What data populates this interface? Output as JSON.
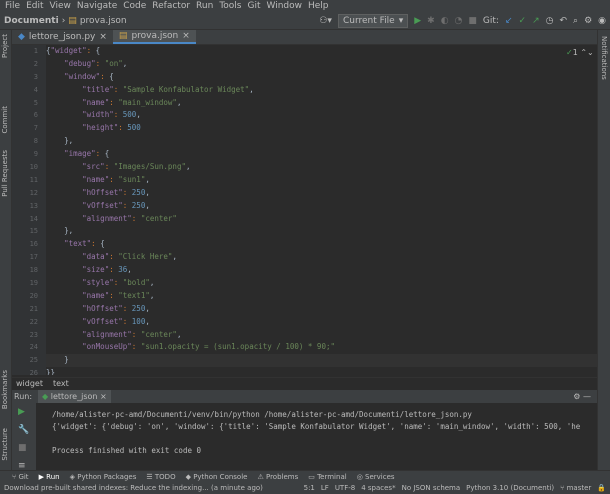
{
  "menu": [
    "File",
    "Edit",
    "View",
    "Navigate",
    "Code",
    "Refactor",
    "Run",
    "Tools",
    "Git",
    "Window",
    "Help"
  ],
  "breadcrumb": {
    "project": "Documenti",
    "file": "prova.json"
  },
  "toolbar": {
    "run_config": "Current File",
    "git_label": "Git:"
  },
  "left_tools": [
    "Project",
    "Commit",
    "Pull Requests"
  ],
  "left_tools_bottom": [
    "Bookmarks",
    "Structure"
  ],
  "right_tools": [
    "Notifications"
  ],
  "tabs": [
    {
      "label": "lettore_json.py"
    },
    {
      "label": "prova.json"
    }
  ],
  "inspection": "1",
  "editor_breadcrumb": [
    "widget",
    "text"
  ],
  "lines": [
    {
      "n": "1",
      "t": "{\"widget\": {"
    },
    {
      "n": "2",
      "t": "    \"debug\": \"on\","
    },
    {
      "n": "3",
      "t": "    \"window\": {"
    },
    {
      "n": "4",
      "t": "        \"title\": \"Sample Konfabulator Widget\","
    },
    {
      "n": "5",
      "t": "        \"name\": \"main_window\","
    },
    {
      "n": "6",
      "t": "        \"width\": 500,"
    },
    {
      "n": "7",
      "t": "        \"height\": 500"
    },
    {
      "n": "8",
      "t": "    },"
    },
    {
      "n": "9",
      "t": "    \"image\": {"
    },
    {
      "n": "10",
      "t": "        \"src\": \"Images/Sun.png\","
    },
    {
      "n": "11",
      "t": "        \"name\": \"sun1\","
    },
    {
      "n": "12",
      "t": "        \"hOffset\": 250,"
    },
    {
      "n": "13",
      "t": "        \"vOffset\": 250,"
    },
    {
      "n": "14",
      "t": "        \"alignment\": \"center\""
    },
    {
      "n": "15",
      "t": "    },"
    },
    {
      "n": "16",
      "t": "    \"text\": {"
    },
    {
      "n": "17",
      "t": "        \"data\": \"Click Here\","
    },
    {
      "n": "18",
      "t": "        \"size\": 36,"
    },
    {
      "n": "19",
      "t": "        \"style\": \"bold\","
    },
    {
      "n": "20",
      "t": "        \"name\": \"text1\","
    },
    {
      "n": "21",
      "t": "        \"hOffset\": 250,"
    },
    {
      "n": "22",
      "t": "        \"vOffset\": 100,"
    },
    {
      "n": "23",
      "t": "        \"alignment\": \"center\","
    },
    {
      "n": "24",
      "t": "        \"onMouseUp\": \"sun1.opacity = (sun1.opacity / 100) * 90;\""
    },
    {
      "n": "25",
      "t": "    }"
    },
    {
      "n": "26",
      "t": "}}"
    }
  ],
  "run": {
    "label": "Run:",
    "tab": "lettore_json"
  },
  "console": [
    "/home/alister-pc-amd/Documenti/venv/bin/python /home/alister-pc-amd/Documenti/lettore_json.py",
    "{'widget': {'debug': 'on', 'window': {'title': 'Sample Konfabulator Widget', 'name': 'main_window', 'width': 500, 'he",
    "",
    "Process finished with exit code 0"
  ],
  "bottom_tabs": [
    "Git",
    "Run",
    "Python Packages",
    "TODO",
    "Python Console",
    "Problems",
    "Terminal",
    "Services"
  ],
  "status": {
    "message": "Download pre-built shared indexes: Reduce the indexing... (a minute ago)",
    "position": "5:1",
    "line_sep": "LF",
    "encoding": "UTF-8",
    "indent": "4 spaces*",
    "schema": "No JSON schema",
    "interpreter": "Python 3.10 (Documenti)",
    "branch": "master"
  }
}
